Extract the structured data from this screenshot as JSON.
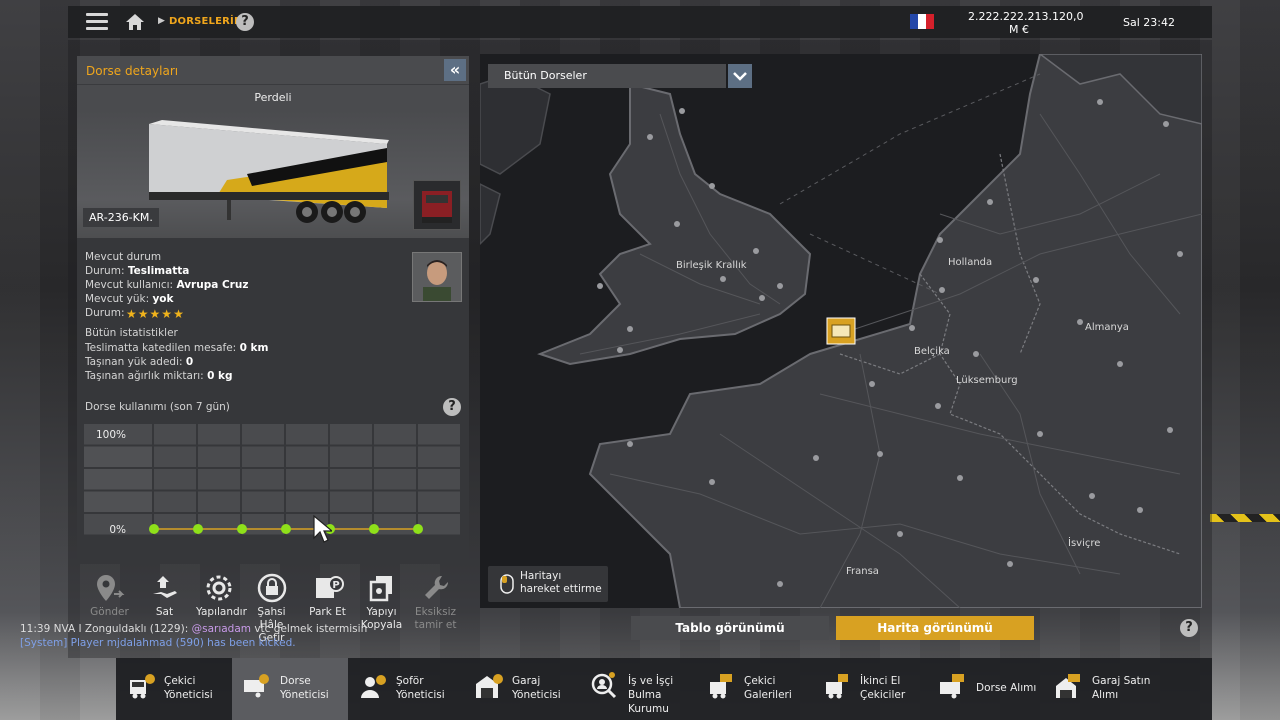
{
  "topbar": {
    "breadcrumb": "DORSELERİM",
    "help": "?",
    "money_line1": "2.222.222.213.120,0",
    "money_line2": "M  €",
    "clock": "Sal 23:42"
  },
  "panel": {
    "title": "Dorse detayları",
    "collapse": "«",
    "trailer_type": "Perdeli",
    "plate": "AR-236-KM.",
    "status_title": "Mevcut durum",
    "status_label": "Durum:",
    "status_value": "Teslimatta",
    "user_label": "Mevcut kullanıcı:",
    "user_value": "Avrupa Cruz",
    "cargo_label": "Mevcut yük:",
    "cargo_value": "yok",
    "condition_label": "Durum:",
    "condition_stars": 5,
    "stats_title": "Bütün istatistikler",
    "dist_label": "Teslimatta katedilen mesafe:",
    "dist_value": "0 km",
    "loads_label": "Taşınan yük adedi:",
    "loads_value": "0",
    "weight_label": "Taşınan ağırlık miktarı:",
    "weight_value": "0 kg",
    "usage_title": "Dorse kullanımı (son 7 gün)",
    "usage_help": "?",
    "usage_max": "100%",
    "usage_min": "0%",
    "usage_values": [
      0,
      0,
      0,
      0,
      0,
      0,
      0
    ]
  },
  "actions": [
    {
      "label": "Gönder",
      "icon": "location-send-icon",
      "enabled": false
    },
    {
      "label": "Sat",
      "icon": "hand-sell-icon",
      "enabled": true
    },
    {
      "label": "Yapılandır",
      "icon": "cog-icon",
      "enabled": true
    },
    {
      "label": "Şahsi Hâle Getir",
      "icon": "lock-icon",
      "enabled": true
    },
    {
      "label": "Park Et",
      "icon": "park-icon",
      "enabled": true
    },
    {
      "label": "Yapıyı Kopyala",
      "icon": "copy-icon",
      "enabled": true
    },
    {
      "label": "Eksiksiz tamir et",
      "icon": "wrench-icon",
      "enabled": false
    }
  ],
  "map": {
    "filter": "Bütün Dorseler",
    "labels": [
      "Birleşik Krallık",
      "Hollanda",
      "Almanya",
      "Belçika",
      "Lüksemburg",
      "İsviçre",
      "Fransa"
    ],
    "move_hint": "Haritayı hareket ettirme",
    "table_view": "Tablo görünümü",
    "map_view": "Harita görünümü",
    "help": "?"
  },
  "chat": {
    "line1_time": "11:39",
    "line1_user": "NVA I Zonguldaklı (1229):",
    "line1_mention": "@sarıadam",
    "line1_text": "vtc gelmek istermisin",
    "line2": "[System] Player mjdalahmad (590) has been kicked."
  },
  "nav": [
    {
      "label1": "Çekici",
      "label2": "Yöneticisi",
      "icon": "truck-manager-icon",
      "active": false
    },
    {
      "label1": "Dorse",
      "label2": "Yöneticisi",
      "icon": "trailer-manager-icon",
      "active": true
    },
    {
      "label1": "Şoför",
      "label2": "Yöneticisi",
      "icon": "driver-manager-icon",
      "active": false
    },
    {
      "label1": "Garaj",
      "label2": "Yöneticisi",
      "icon": "garage-manager-icon",
      "active": false
    },
    {
      "label1": "İş ve İşçi",
      "label2": "Bulma Kurumu",
      "icon": "job-agency-icon",
      "active": false
    },
    {
      "label1": "Çekici",
      "label2": "Galerileri",
      "icon": "truck-dealer-icon",
      "active": false
    },
    {
      "label1": "İkinci El",
      "label2": "Çekiciler",
      "icon": "used-truck-icon",
      "active": false
    },
    {
      "label1": "Dorse Alımı",
      "label2": "",
      "icon": "trailer-buy-icon",
      "active": false
    },
    {
      "label1": "Garaj Satın",
      "label2": "Alımı",
      "icon": "garage-buy-icon",
      "active": false
    }
  ],
  "colors": {
    "accent": "#f0a61c",
    "active_button": "#d8a122",
    "button_blue": "#5d6f84"
  }
}
